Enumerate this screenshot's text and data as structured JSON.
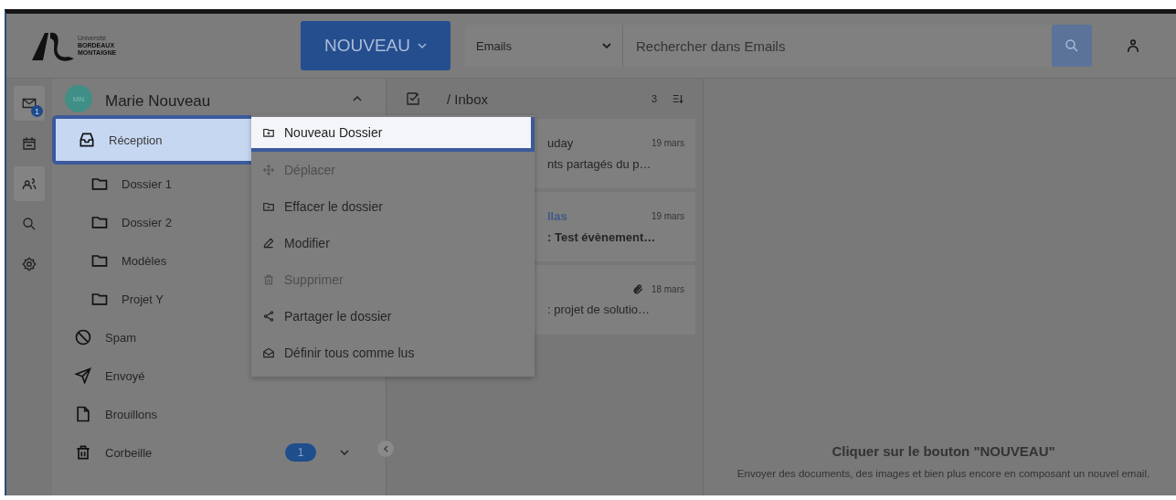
{
  "header": {
    "logo_lines": [
      "Université",
      "BORDEAUX",
      "MONTAIGNE"
    ],
    "new_button": "NOUVEAU",
    "scope_select": "Emails",
    "search": {
      "placeholder": "Rechercher dans Emails"
    }
  },
  "rail": [
    {
      "kind": "mail",
      "badge": "1",
      "selected": true
    },
    {
      "kind": "calendar",
      "selected": false
    },
    {
      "kind": "contacts",
      "selected": true
    },
    {
      "kind": "search",
      "selected": false
    },
    {
      "kind": "settings",
      "selected": false
    }
  ],
  "account": {
    "initials": "MN",
    "name": "Marie Nouveau",
    "expanded": true
  },
  "folders": [
    {
      "kind": "inbox",
      "label": "Réception",
      "selected": true,
      "children": [
        {
          "kind": "folder",
          "label": "Dossier 1",
          "selected": false
        },
        {
          "kind": "folder",
          "label": "Dossier 2",
          "selected": false
        },
        {
          "kind": "folder",
          "label": "Modèles",
          "selected": false
        },
        {
          "kind": "folder",
          "label": "Projet Y",
          "selected": false
        }
      ]
    },
    {
      "kind": "spam",
      "label": "Spam",
      "selected": false
    },
    {
      "kind": "sent",
      "label": "Envoyé",
      "selected": false
    },
    {
      "kind": "draft",
      "label": "Brouillons",
      "selected": false
    },
    {
      "kind": "trash",
      "label": "Corbeille",
      "selected": false,
      "badge": "1"
    }
  ],
  "list_header": {
    "title": "/ Inbox",
    "count": "3"
  },
  "messages": [
    {
      "sender": "uday",
      "date": "19 mars",
      "subject": "nts partagés du p…",
      "unread": false,
      "attachment": false
    },
    {
      "sender": "llas",
      "date": "19 mars",
      "subject": ": Test évènement…",
      "unread": true,
      "attachment": false
    },
    {
      "date": "18 mars",
      "subject": ": projet de solutio…",
      "unread": false,
      "attachment": true
    }
  ],
  "context_menu": [
    {
      "kind": "folder-plus",
      "label": "Nouveau Dossier",
      "selected": true,
      "disabled": false
    },
    {
      "kind": "move",
      "label": "Déplacer",
      "selected": false,
      "disabled": true
    },
    {
      "kind": "folder-minus",
      "label": "Effacer le dossier",
      "selected": false,
      "disabled": false
    },
    {
      "kind": "edit",
      "label": "Modifier",
      "selected": false,
      "disabled": false
    },
    {
      "kind": "trash",
      "label": "Supprimer",
      "selected": false,
      "disabled": true
    },
    {
      "kind": "share",
      "label": "Partager le dossier",
      "selected": false,
      "disabled": false
    },
    {
      "kind": "read",
      "label": "Définir tous comme lus",
      "selected": false,
      "disabled": false
    }
  ],
  "empty_state": {
    "title": "Cliquer sur le bouton \"NOUVEAU\"",
    "text": "Envoyer des documents, des images et bien plus encore en composant un nouvel email."
  }
}
